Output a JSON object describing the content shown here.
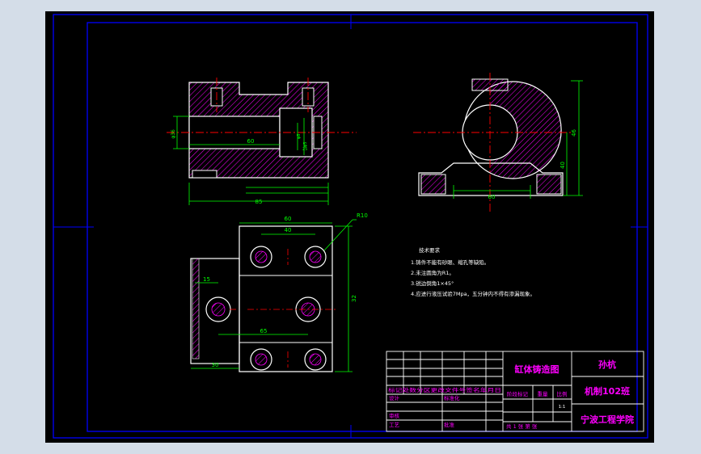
{
  "drawing": {
    "title": "缸体铸造图",
    "author": "孙杭",
    "class_name": "机制102班",
    "school": "宁波工程学院",
    "revision_header": "标记处数分区更改文件号签名年月日",
    "row_design": "设计",
    "row_standard": "标准化",
    "row_review": "审核",
    "row_process": "工艺",
    "row_approve": "批准",
    "stage_label": "阶段标记",
    "weight_label": "重量",
    "scale_label": "比例",
    "scale_value": "1:1",
    "sheets_label": "共 1 张 第  张"
  },
  "tech_notes": {
    "heading": "技术要求",
    "items": [
      "1.铸件不能有砂眼、缩孔等缺陷。",
      "2.未注圆角为R1。",
      "3.锐边倒角1×45°",
      "4.应进行液压试验7Mpa，五分钟内不得有渗漏现象。"
    ]
  },
  "dimensions": {
    "front_overall_width": "85",
    "front_bore_length": "60",
    "front_bore_dia": "φ36",
    "front_small_a": "φ8",
    "front_small_b": "φ5",
    "front_small_c": "25",
    "side_height": "46",
    "side_total": "40",
    "side_base_width": "60",
    "top_outer_span": "60",
    "top_inner_span": "40",
    "top_radius": "R10",
    "top_left_offset": "15",
    "top_hole_span": "65",
    "top_height": "32",
    "top_base_width": "30"
  },
  "colors": {
    "background": "#000000",
    "frame": "#0000ff",
    "outline": "#ffffff",
    "dimension": "#00ff00",
    "centerline": "#ff0000",
    "hatch": "#ff00ff",
    "text": "#ff00ff"
  }
}
